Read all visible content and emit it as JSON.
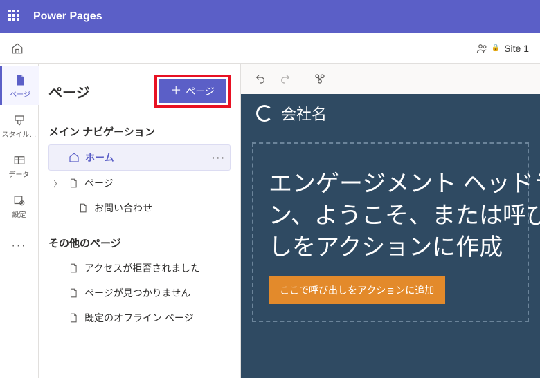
{
  "header": {
    "app_title": "Power Pages"
  },
  "command_bar": {
    "site_label": "Site 1"
  },
  "rail": {
    "items": [
      {
        "key": "pages",
        "label": "ページ"
      },
      {
        "key": "style",
        "label": "スタイル…"
      },
      {
        "key": "data",
        "label": "データ"
      },
      {
        "key": "setup",
        "label": "設定"
      },
      {
        "key": "more",
        "label": ""
      }
    ]
  },
  "side_panel": {
    "title": "ページ",
    "add_page_label": "ページ",
    "section_main_nav": "メイン ナビゲーション",
    "section_other": "その他のページ",
    "nav_items": {
      "home": "ホーム",
      "page": "ページ",
      "contact": "お問い合わせ"
    },
    "other_items": {
      "access_denied": "アクセスが拒否されました",
      "not_found": "ページが見つかりません",
      "offline": "既定のオフライン ページ"
    }
  },
  "canvas": {
    "company_name": "会社名",
    "hero_line1": "エンゲージメント ヘッドライ",
    "hero_line2": "ン、ようこそ、または呼び出",
    "hero_line3": "しをアクションに作成",
    "cta_label": "ここで呼び出しをアクションに追加"
  }
}
